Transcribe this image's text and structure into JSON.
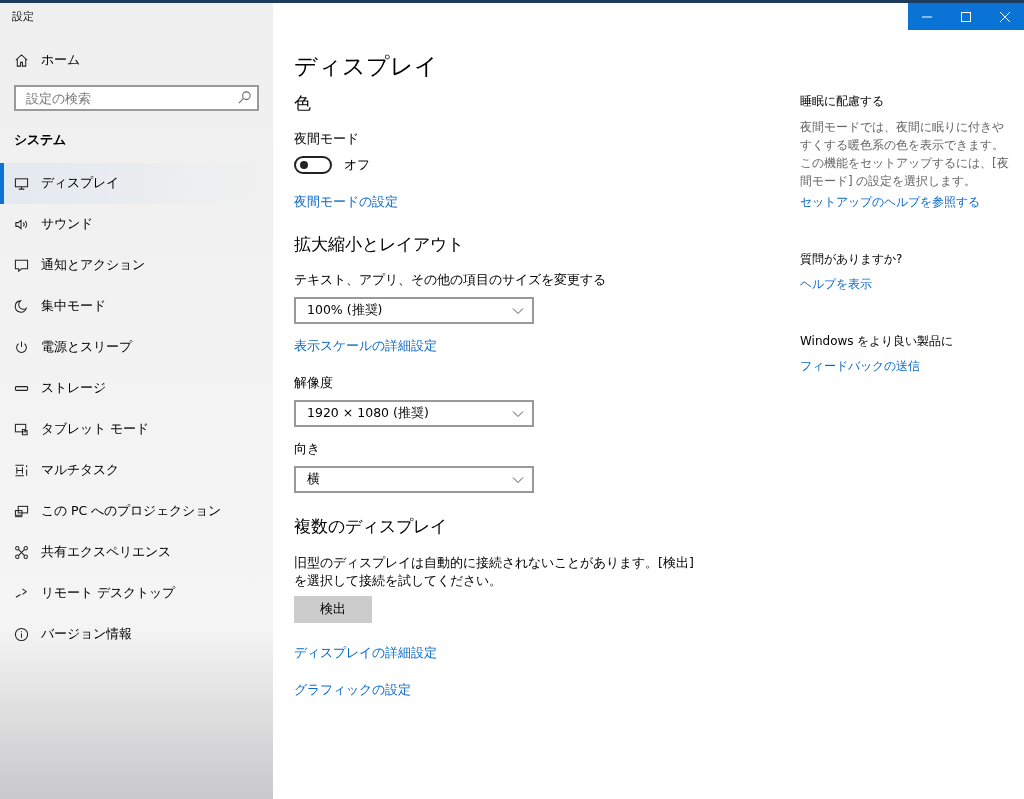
{
  "window": {
    "title": "設定"
  },
  "sidebar": {
    "home": "ホーム",
    "search": {
      "placeholder": "設定の検索"
    },
    "section": "システム",
    "items": [
      {
        "label": "ディスプレイ",
        "selected": true
      },
      {
        "label": "サウンド",
        "selected": false
      },
      {
        "label": "通知とアクション",
        "selected": false
      },
      {
        "label": "集中モード",
        "selected": false
      },
      {
        "label": "電源とスリープ",
        "selected": false
      },
      {
        "label": "ストレージ",
        "selected": false
      },
      {
        "label": "タブレット モード",
        "selected": false
      },
      {
        "label": "マルチタスク",
        "selected": false
      },
      {
        "label": "この PC へのプロジェクション",
        "selected": false
      },
      {
        "label": "共有エクスペリエンス",
        "selected": false
      },
      {
        "label": "リモート デスクトップ",
        "selected": false
      },
      {
        "label": "バージョン情報",
        "selected": false
      }
    ]
  },
  "main": {
    "title": "ディスプレイ",
    "sections": [
      {
        "heading": "色",
        "blocks": [
          {
            "kind": "toggle",
            "label": "夜間モード",
            "on": false,
            "state": "オフ"
          },
          {
            "kind": "link",
            "text": "夜間モードの設定"
          }
        ]
      },
      {
        "heading": "拡大縮小とレイアウト",
        "blocks": [
          {
            "kind": "dropdown",
            "label": "テキスト、アプリ、その他の項目のサイズを変更する",
            "value": "100% (推奨)"
          },
          {
            "kind": "link",
            "text": "表示スケールの詳細設定"
          },
          {
            "kind": "dropdown",
            "label": "解像度",
            "value": "1920 × 1080 (推奨)"
          },
          {
            "kind": "dropdown",
            "label": "向き",
            "value": "横"
          }
        ]
      },
      {
        "heading": "複数のディスプレイ",
        "blocks": [
          {
            "kind": "text",
            "text": "旧型のディスプレイは自動的に接続されないことがあります。[検出] を選択して接続を試してください。"
          },
          {
            "kind": "button",
            "text": "検出"
          },
          {
            "kind": "link",
            "text": "ディスプレイの詳細設定"
          },
          {
            "kind": "link",
            "text": "グラフィックの設定"
          }
        ]
      }
    ]
  },
  "aside": [
    {
      "heading": "睡眠に配慮する",
      "text": "夜間モードでは、夜間に眠りに付きやすくする暖色系の色を表示できます。この機能をセットアップするには、[夜間モード] の設定を選択します。",
      "link": "セットアップのヘルプを参照する"
    },
    {
      "heading": "質問がありますか?",
      "link": "ヘルプを表示"
    },
    {
      "heading": "Windows をより良い製品に",
      "link": "フィードバックの送信"
    }
  ]
}
